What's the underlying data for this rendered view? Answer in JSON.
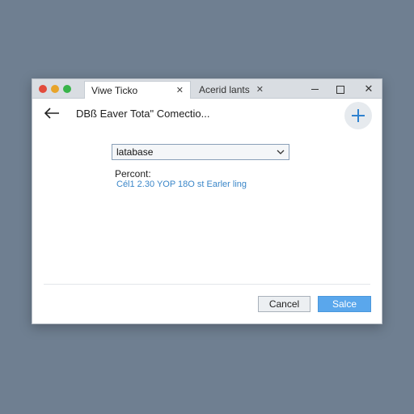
{
  "window": {
    "tabs": [
      {
        "label": "Viwe Ticko",
        "close": "✕"
      },
      {
        "label": "Acerid lants",
        "close": "✕"
      }
    ],
    "controls": {
      "close": "✕"
    }
  },
  "header": {
    "title": "DBß Eaver Tota\" Comectio..."
  },
  "form": {
    "database_select_value": "latabase",
    "percent_label": "Percont:",
    "status_text": "Cél1 2.30 YOP 18O st Earler ling"
  },
  "footer": {
    "cancel_label": "Cancel",
    "save_label": "Salce"
  },
  "colors": {
    "accent": "#5aa7ec",
    "link": "#3a86c8",
    "backdrop": "#6f7f91"
  }
}
